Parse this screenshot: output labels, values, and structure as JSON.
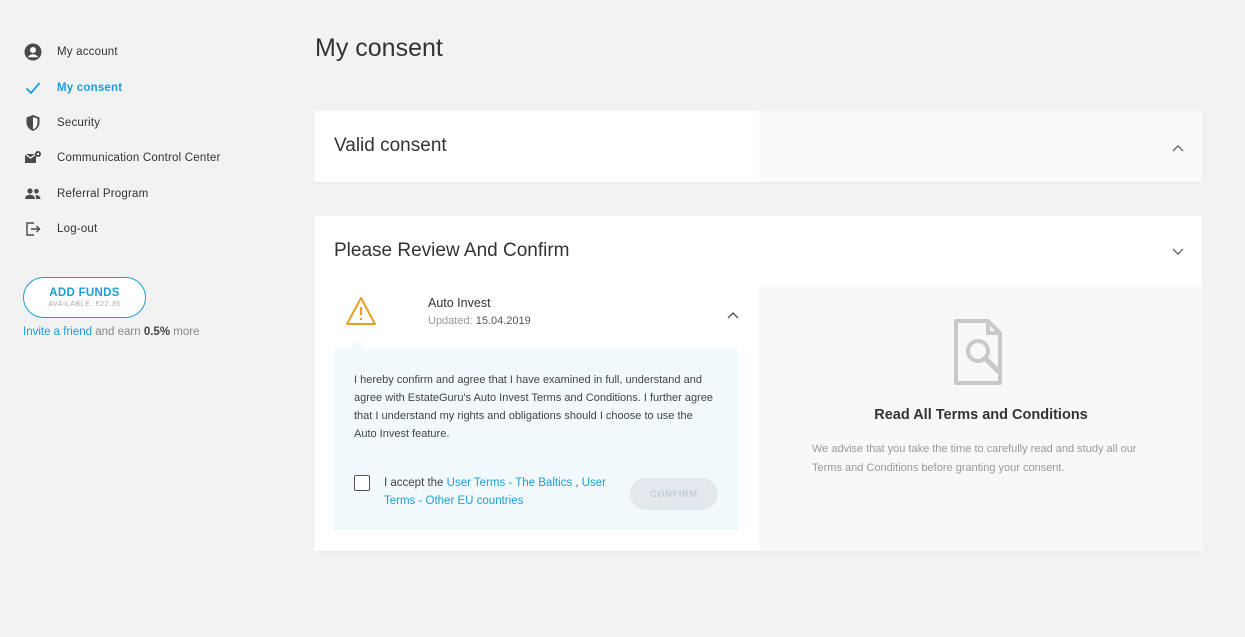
{
  "sidebar": {
    "items": [
      {
        "label": "My account",
        "icon": "account-circle-icon"
      },
      {
        "label": "My consent",
        "icon": "check-icon",
        "active": true
      },
      {
        "label": "Security",
        "icon": "shield-icon"
      },
      {
        "label": "Communication Control Center",
        "icon": "mail-settings-icon"
      },
      {
        "label": "Referral Program",
        "icon": "people-icon"
      },
      {
        "label": "Log-out",
        "icon": "logout-icon"
      }
    ],
    "add_funds": {
      "label": "ADD FUNDS",
      "available": "AVAILABLE: €22.36"
    },
    "invite": {
      "link": "Invite a friend",
      "middle": " and earn ",
      "percent": "0.5%",
      "suffix": " more"
    }
  },
  "main": {
    "title": "My consent",
    "valid_consent": {
      "title": "Valid consent"
    },
    "review": {
      "title": "Please Review And Confirm",
      "item": {
        "name": "Auto Invest",
        "updated_label": "Updated:",
        "updated_date": "15.04.2019",
        "text": "I hereby confirm and agree that I have examined in full, understand and agree with EstateGuru's Auto Invest Terms and Conditions. I further agree that I understand my rights and obligations should I choose to use the Auto Invest feature.",
        "accept_prefix": "I accept the ",
        "terms_baltics": "User Terms - The Baltics",
        "separator": " , ",
        "terms_other": "User Terms - Other EU countries",
        "confirm_label": "CONFIRM"
      },
      "info": {
        "title": "Read All Terms and Conditions",
        "text": "We advise that you take the time to carefully read and study all our Terms and Conditions before granting your consent."
      }
    }
  },
  "colors": {
    "accent": "#1a9fd6",
    "warning": "#e8a023",
    "background": "#f2f2f3"
  }
}
